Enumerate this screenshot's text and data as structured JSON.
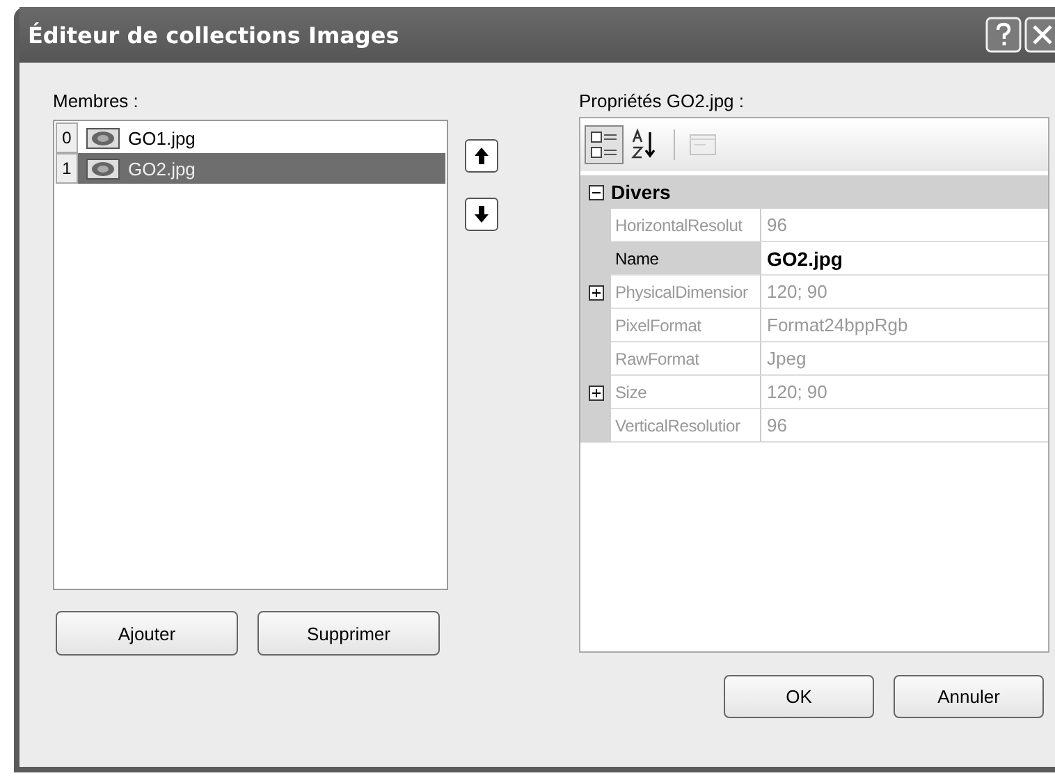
{
  "window": {
    "title": "Éditeur de collections Images"
  },
  "members": {
    "label": "Membres :",
    "items": [
      {
        "index": "0",
        "name": "GO1.jpg",
        "selected": false
      },
      {
        "index": "1",
        "name": "GO2.jpg",
        "selected": true
      }
    ]
  },
  "move_buttons": [
    {
      "kind": "up"
    },
    {
      "kind": "down"
    }
  ],
  "list_buttons": [
    "Ajouter",
    "Supprimer"
  ],
  "properties": {
    "label": "Propriétés GO2.jpg :",
    "toolbar": [
      {
        "kind": "categorized",
        "selected": true,
        "disabled": false
      },
      {
        "kind": "alphabetical",
        "selected": false,
        "disabled": false
      },
      {
        "kind": "pages",
        "selected": false,
        "disabled": true
      }
    ],
    "category": {
      "name": "Divers",
      "expanded": true
    },
    "rows": [
      {
        "name": "HorizontalResolut",
        "value": "96",
        "expandable": false,
        "readonly": true,
        "selected": false,
        "modified": false
      },
      {
        "name": "Name",
        "value": "GO2.jpg",
        "expandable": false,
        "readonly": false,
        "selected": true,
        "modified": true
      },
      {
        "name": "PhysicalDimensior",
        "value": "120; 90",
        "expandable": true,
        "readonly": true,
        "selected": false,
        "modified": false
      },
      {
        "name": "PixelFormat",
        "value": "Format24bppRgb",
        "expandable": false,
        "readonly": true,
        "selected": false,
        "modified": false
      },
      {
        "name": "RawFormat",
        "value": "Jpeg",
        "expandable": false,
        "readonly": true,
        "selected": false,
        "modified": false
      },
      {
        "name": "Size",
        "value": "120; 90",
        "expandable": true,
        "readonly": true,
        "selected": false,
        "modified": false
      },
      {
        "name": "VerticalResolutior",
        "value": "96",
        "expandable": false,
        "readonly": true,
        "selected": false,
        "modified": false
      }
    ]
  },
  "dialog_buttons": [
    "OK",
    "Annuler"
  ]
}
